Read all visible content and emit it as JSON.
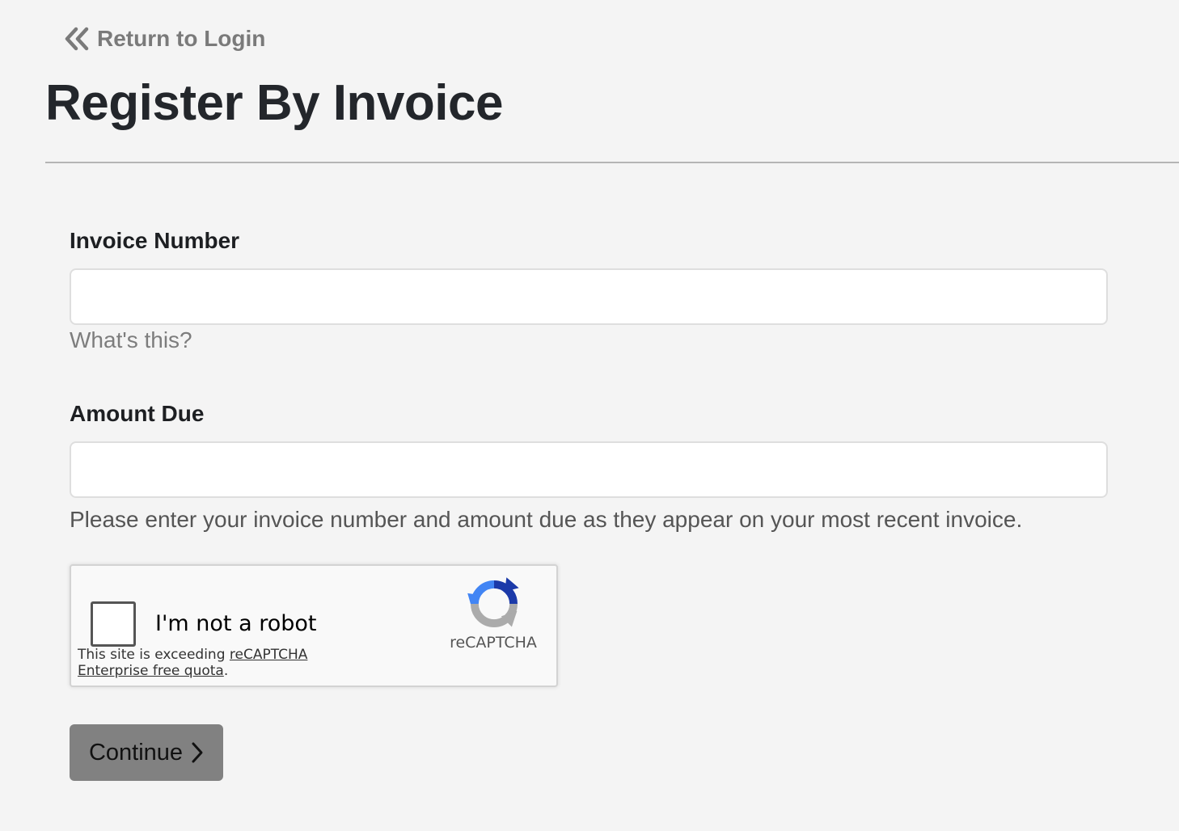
{
  "back_link": {
    "label": "Return to Login",
    "icon": "double-chevron-left-icon"
  },
  "page_title": "Register By Invoice",
  "form": {
    "invoice_number": {
      "label": "Invoice Number",
      "value": "",
      "placeholder": ""
    },
    "whats_this_link": "What's this?",
    "amount_due": {
      "label": "Amount Due",
      "value": "",
      "placeholder": ""
    },
    "help_text": "Please enter your invoice number and amount due as they appear on your most recent invoice."
  },
  "captcha": {
    "label": "I'm not a robot",
    "warning_prefix": "This site is exceeding ",
    "warning_link": "reCAPTCHA Enterprise free quota",
    "warning_suffix": ".",
    "brand": "reCAPTCHA",
    "icon": "recaptcha-logo-icon"
  },
  "continue_button": {
    "label": "Continue",
    "icon": "chevron-right-icon"
  },
  "colors": {
    "background": "#f4f4f4",
    "title": "#23262b",
    "muted": "#7a7a7a",
    "button": "#818181"
  }
}
